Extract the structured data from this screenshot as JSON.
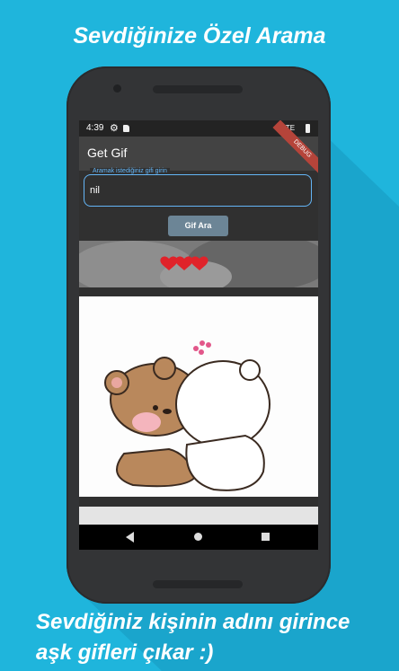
{
  "promo": {
    "headline": "Sevdiğinize Özel Arama",
    "caption_line1": "Sevdiğiniz kişinin adını girince",
    "caption_line2": "aşk gifleri çıkar :)"
  },
  "statusbar": {
    "time": "4:39",
    "network": "LTE"
  },
  "appbar": {
    "title": "Get Gif",
    "debug_banner": "DEBUG"
  },
  "search": {
    "label": "Aramak istediğiniz gifi girin",
    "value": "nil"
  },
  "search_button": {
    "label": "Gif Ara"
  },
  "icons": [
    "gear-icon",
    "sd-card-icon",
    "battery-icon",
    "back-icon",
    "home-icon",
    "recent-apps-icon"
  ],
  "colors": {
    "background": "#1fb5dc",
    "accent": "#64b5f6",
    "button": "#6c8596",
    "appbar": "#434343"
  }
}
